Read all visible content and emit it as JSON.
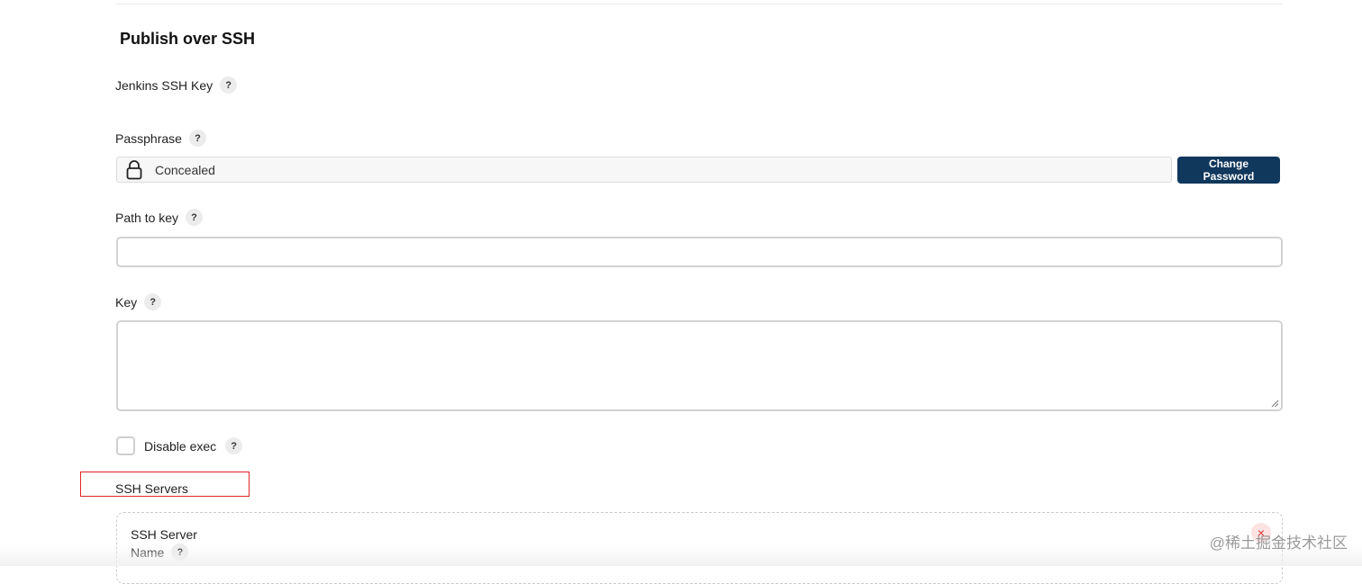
{
  "section": {
    "title": "Publish over SSH"
  },
  "fields": {
    "jenkins_ssh_key_label": "Jenkins SSH Key",
    "passphrase_label": "Passphrase",
    "passphrase_value": "Concealed",
    "change_password_label": "Change Password",
    "path_to_key_label": "Path to key",
    "path_to_key_value": "",
    "key_label": "Key",
    "key_value": "",
    "disable_exec_label": "Disable exec"
  },
  "help_glyph": "?",
  "ssh_servers": {
    "label": "SSH Servers",
    "card_title": "SSH Server",
    "name_label": "Name",
    "delete_glyph": "×"
  },
  "watermark": "@稀土掘金技术社区",
  "colors": {
    "primary_button": "#10375c",
    "highlight_border": "#e02424",
    "delete_accent": "#dd3333"
  },
  "icons": [
    "lock-icon",
    "help-icon",
    "close-icon",
    "resize-grip-icon"
  ]
}
